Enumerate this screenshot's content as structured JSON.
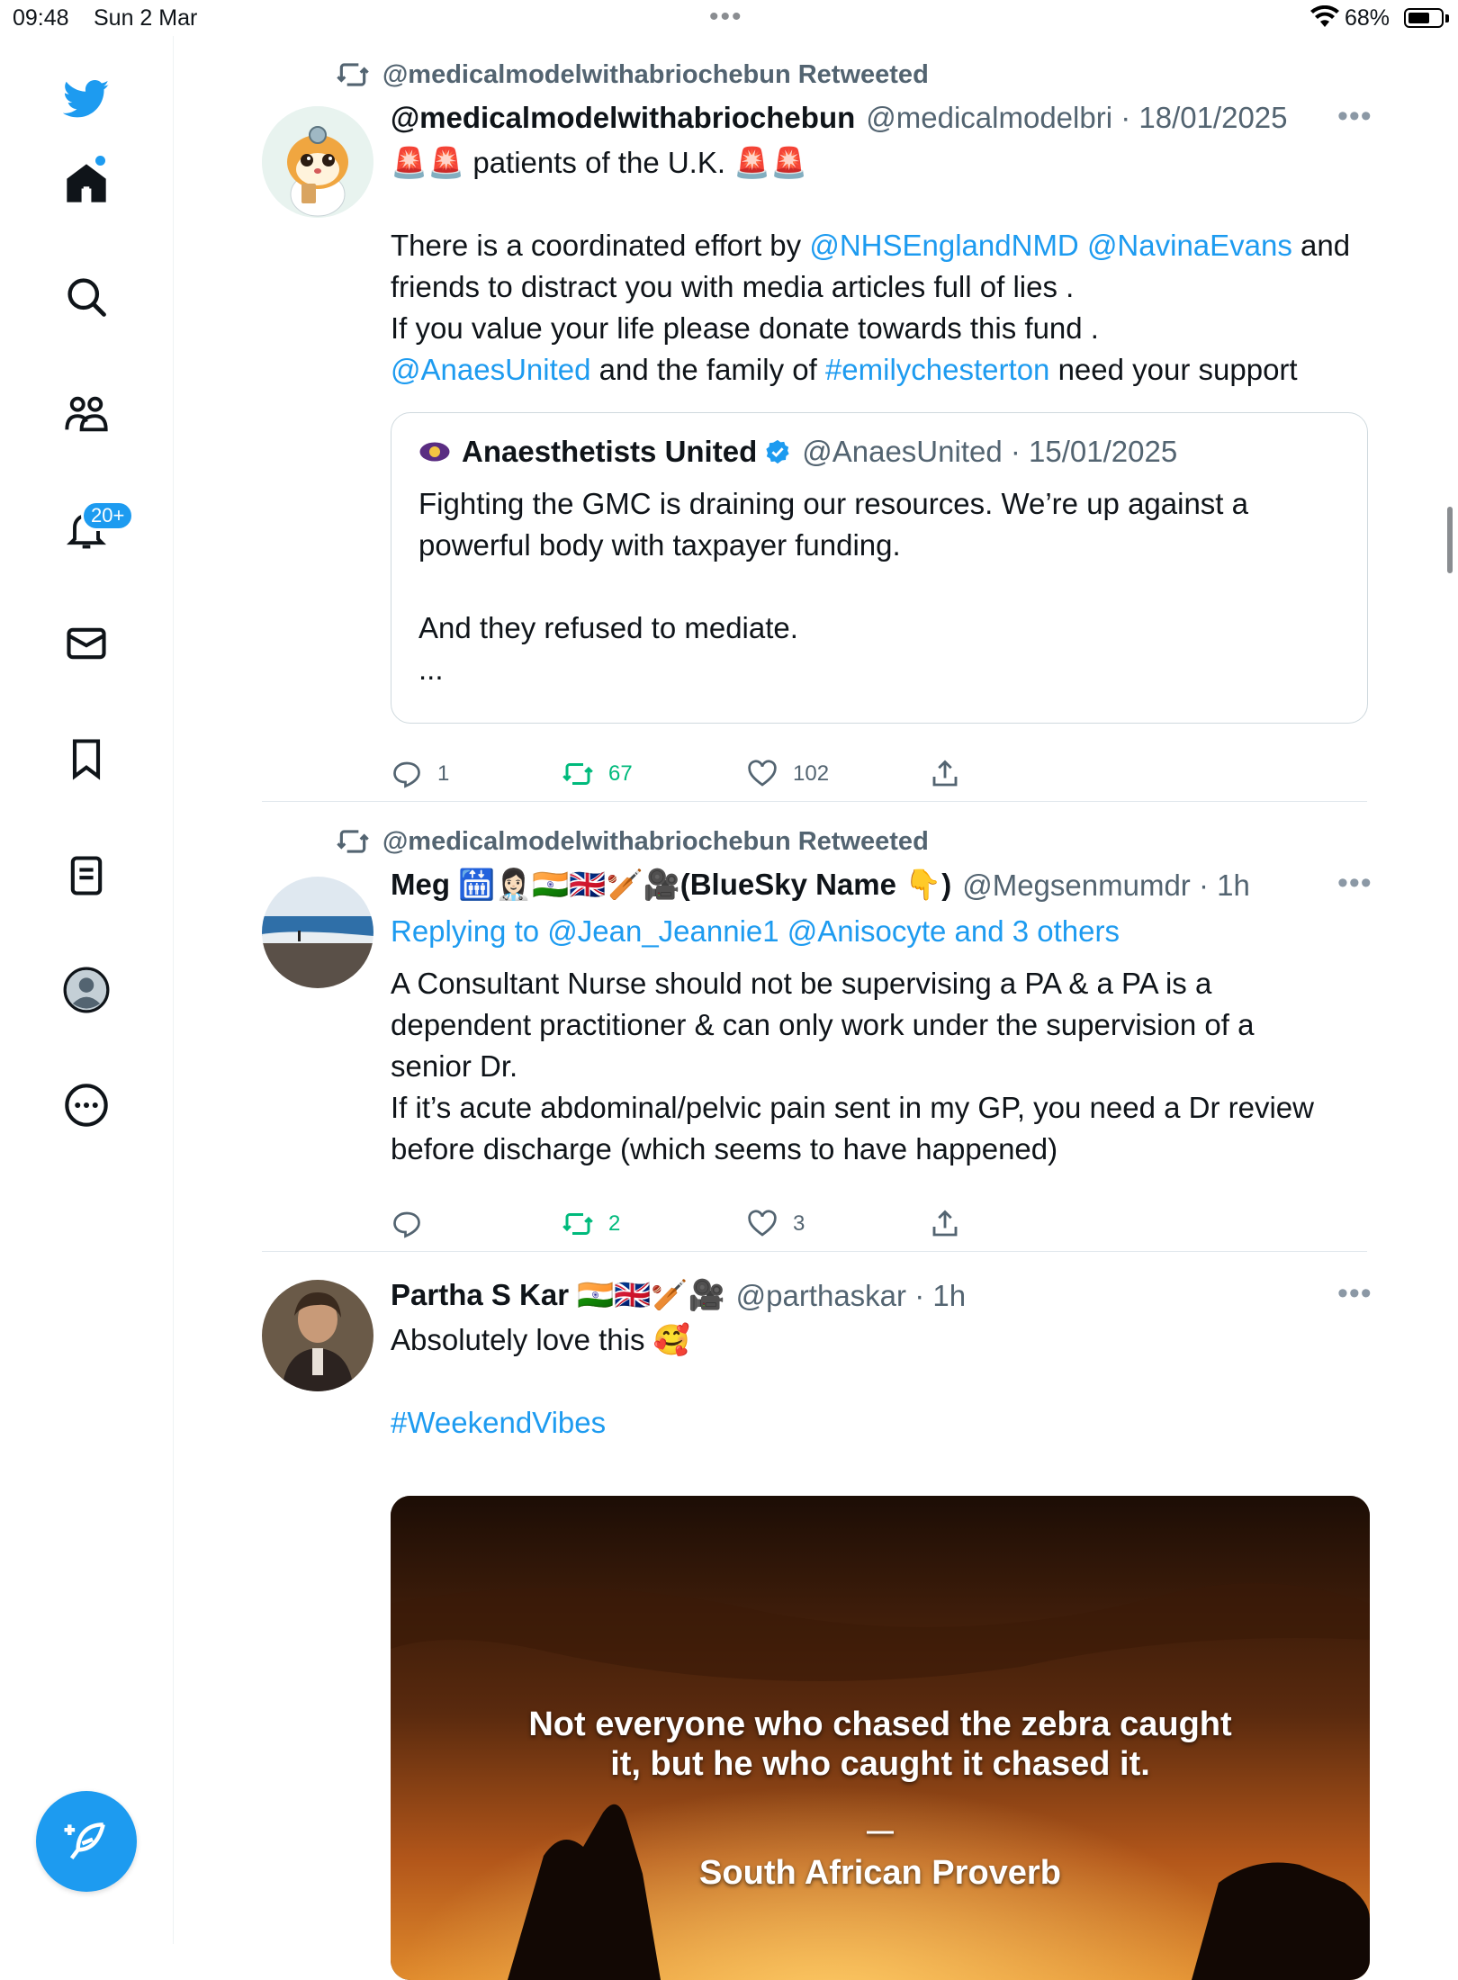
{
  "status_bar": {
    "time": "09:48",
    "date": "Sun 2 Mar",
    "battery": "68%",
    "battery_level": 0.68
  },
  "sidebar": {
    "items": [
      {
        "name": "home",
        "icon": "home-icon"
      },
      {
        "name": "explore",
        "icon": "search-icon"
      },
      {
        "name": "communities",
        "icon": "people-icon"
      },
      {
        "name": "notifications",
        "icon": "bell-icon",
        "badge": "20+"
      },
      {
        "name": "messages",
        "icon": "mail-icon"
      },
      {
        "name": "bookmarks",
        "icon": "bookmark-icon"
      },
      {
        "name": "lists",
        "icon": "list-icon"
      },
      {
        "name": "profile",
        "icon": "avatar-icon"
      },
      {
        "name": "more",
        "icon": "more-circle-icon"
      }
    ],
    "compose_icon": "feather-plus-icon"
  },
  "colors": {
    "accent": "#1d9bf0",
    "retweet": "#00ba7c",
    "muted": "#536471"
  },
  "tweets": [
    {
      "retweeted_by": "@medicalmodelwithabriochebun Retweeted",
      "name": "@medicalmodelwithabriochebun",
      "meta": "@medicalmodelbri · 18/01/2025",
      "line1_text": " patients of the U.K. ",
      "line2": [
        "There is a coordinated effort by ",
        "@NHSEnglandNMD",
        " ",
        "@NavinaEvans",
        " and"
      ],
      "line3": "friends to distract you with media articles full of lies .",
      "line4": "If you value your life please donate towards this fund .",
      "line5": [
        "@AnaesUnited",
        " and the family of ",
        "#emilychesterton",
        " need your support"
      ],
      "quote": {
        "name": "Anaesthetists United",
        "meta": "@AnaesUnited · 15/01/2025",
        "line1": "Fighting the GMC is draining our resources. We’re up against a",
        "line2": "powerful body with taxpayer funding.",
        "line3": "And they refused to mediate.",
        "line4": "..."
      },
      "replies": "1",
      "retweets": "67",
      "likes": "102"
    },
    {
      "retweeted_by": "@medicalmodelwithabriochebun Retweeted",
      "name": "Meg 🛗👩🏻‍⚕️🇮🇳🇬🇧🏏🎥(BlueSky Name 👇)",
      "meta": "@Megsenmumdr · 1h",
      "replying": [
        "Replying to ",
        "@Jean_Jeannie1 @Anisocyte and 3 others"
      ],
      "lines": [
        "A Consultant Nurse should not be supervising a PA & a PA is a",
        "dependent practitioner & can only work under the supervision of a",
        "senior Dr.",
        "If it’s acute abdominal/pelvic pain sent in my GP, you need a Dr review",
        "before discharge (which seems to have happened)"
      ],
      "replies": "",
      "retweets": "2",
      "likes": "3"
    },
    {
      "name": "Partha S Kar 🇮🇳🇬🇧🏏🎥",
      "meta": "@parthaskar · 1h",
      "line1": "Absolutely love this 🥰",
      "hashtag": "#WeekendVibes",
      "media": {
        "quote_line1": "Not everyone who chased the zebra caught",
        "quote_line2": "it, but he who caught it chased it.",
        "dash": "—",
        "attribution": "South African Proverb"
      }
    }
  ]
}
